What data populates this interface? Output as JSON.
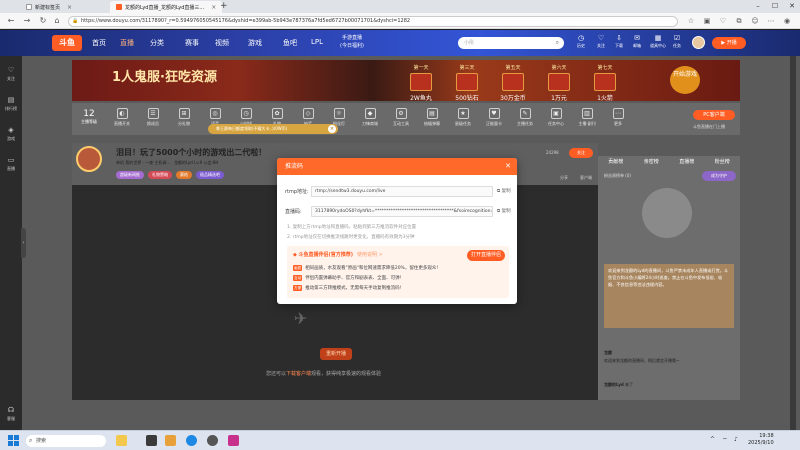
{
  "browser": {
    "tabs": [
      {
        "title": "新建标签页"
      },
      {
        "title": "龙额的Lyd直播_龙额的Lyd直播三..."
      }
    ],
    "url": "https://www.douyu.com/3117890?_r=0.594976050545176&dyshid=e399ab-5b943e787376a7fd5ed6727b00071701&dyshci=1282"
  },
  "site": {
    "logo": "斗鱼",
    "nav": [
      "首页",
      "直播",
      "分类",
      "赛事",
      "视频",
      "游戏",
      "鱼吧",
      "LPL"
    ],
    "game_btn": {
      "line1": "手游直播",
      "line2": "(今日福利)"
    },
    "search_placeholder": "小彤",
    "header_icons": [
      "历史",
      "关注",
      "下载",
      "邮箱",
      "道具中心",
      "任务"
    ],
    "start_live": "开播"
  },
  "sidebar": {
    "items": [
      "关注",
      "排行榜",
      "游戏",
      "直播"
    ],
    "bottom": "客服"
  },
  "banner": {
    "title": "1人鬼服·狂吃资源",
    "days": [
      {
        "day": "第一天",
        "value": "2W鱼丸"
      },
      {
        "day": "第三天",
        "value": "500钻石"
      },
      {
        "day": "第五天",
        "value": "30万金币"
      },
      {
        "day": "第六天",
        "value": "1万元"
      },
      {
        "day": "第七天",
        "value": "1火箭"
      }
    ],
    "start_btn": "开始游戏"
  },
  "toolbar": {
    "level": "12",
    "level_label": "主播等级",
    "tools": [
      "直播开关",
      "换成员",
      "分礼物",
      "语音",
      "小时排",
      "礼物",
      "抽奖",
      "粉丝灯",
      "刀锋商城",
      "互动工具",
      "抽幅弹幕",
      "星级任务",
      "正能量卡",
      "主播任务",
      "任务中心",
      "主播·副刊",
      "更多"
    ],
    "tip": "拳王赛每日额度领取(不耀大卡..)(0W币)",
    "pc_client": "PC客户端",
    "pc_sub": "斗鱼直播在门上播"
  },
  "room": {
    "title": "泪目！玩了5000个小时的游戏出二代啦！",
    "meta_prefix": "单机",
    "category": "我的世界",
    "subcategory": "一夜·主机调...",
    "anchor": "龙额的Lyd",
    "level": "Lv.9",
    "location": "公会:8H",
    "tags": [
      "超级新闻推",
      "礼物赞暗",
      "赛结",
      "极品精选吧"
    ],
    "fans": "24298",
    "follow": "关注",
    "share": "分享",
    "client": "客户端",
    "report": "举报"
  },
  "video": {
    "open_btn": "重新开播",
    "hint_prefix": "您还可以",
    "hint_link": "下载客户端",
    "hint_suffix": "观看，获得纯享极速的观看体验"
  },
  "chat": {
    "tabs": [
      "贡献榜",
      "亲密榜",
      "直播榜",
      "粉丝榜"
    ],
    "rank": "粉丝周榜单 (0)",
    "guard_btn": "成为守护",
    "broadcast": "欢迎来到龙额的Lyd的直播间，斗鱼严禁未成年人直播或打赏。斗鱼官方和斗鱼小编将24小时巡查。禁止在斗鱼中发布低俗、吸烟、不良信息等违法违规内容。",
    "user1": "龙额",
    "user1_msg": "欢迎来到龙额的直播间，稍后就会开播哦~",
    "user2": "龙额的Lyd",
    "user2_msg": "来了"
  },
  "dialog": {
    "title": "推流码",
    "rtmp_label": "rtmp地址:",
    "rtmp_value": "rtmp://sendtw3.douyu.com/live",
    "key_label": "直播码:",
    "key_value": "3117890rydoOS0?dyhfkt=***********************************&fsoirecognition=0",
    "copy": "复制",
    "note1": "1. 复制上方rtmp地址和直播码，粘贴到第三方推流软件对应位置",
    "note2": "2. rtmp地址仅在切换推流线路时更变化，直播码有效期为3分钟",
    "promo_title": "斗鱼直播伴侣(官方推荐)",
    "promo_link": "使用说明 >",
    "promo_btn": "打开直播伴侣",
    "promo_rows": [
      {
        "tag": "画质",
        "text": "相同画质，水友观看\"原画\"和位网速需求降低20%，留住更多观众!"
      },
      {
        "tag": "互动",
        "text": "伴侣内置弹幕助手、官方和剧表表、全面、可弹!"
      },
      {
        "tag": "方便",
        "text": "推动第三方转推模式，无需每天手动复制推流码!"
      }
    ]
  },
  "taskbar": {
    "search": "搜索",
    "time": "19:38",
    "date": "2025/9/10"
  },
  "colors": {
    "accent": "#ff5d23",
    "header": "#2b3fa6",
    "dialog_header": "#ff6a2a"
  }
}
